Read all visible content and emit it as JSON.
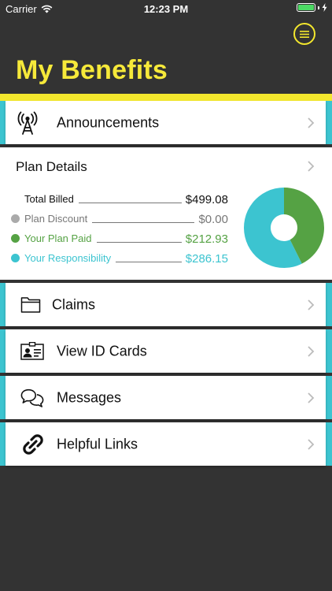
{
  "status": {
    "carrier": "Carrier",
    "time": "12:23 PM",
    "battery_percent": 100
  },
  "header": {
    "title": "My Benefits",
    "menu_icon": "hamburger-icon"
  },
  "colors": {
    "accent_yellow": "#f3e72d",
    "accent_teal": "#3cc4d0",
    "background": "#333333",
    "paid_green": "#55a244",
    "discount_gray": "#aaaaaa",
    "responsibility_teal": "#3cc4d0"
  },
  "announcements": {
    "label": "Announcements",
    "icon": "antenna-icon"
  },
  "plan_details": {
    "title": "Plan Details",
    "lines": [
      {
        "label": "Total Billed",
        "value": "$499.08",
        "color": "#111111"
      },
      {
        "label": "Plan Discount",
        "value": "$0.00",
        "color": "#777777",
        "dot": "#aaaaaa"
      },
      {
        "label": "Your Plan Paid",
        "value": "$212.93",
        "color": "#55a244",
        "dot": "#55a244"
      },
      {
        "label": "Your Responsibility",
        "value": "$286.15",
        "color": "#3cc4d0",
        "dot": "#3cc4d0"
      }
    ]
  },
  "chart_data": {
    "type": "pie",
    "donut": true,
    "slices": [
      {
        "name": "Your Plan Paid",
        "value": 212.93,
        "color": "#55a244"
      },
      {
        "name": "Your Responsibility",
        "value": 286.15,
        "color": "#3cc4d0"
      },
      {
        "name": "Plan Discount",
        "value": 0.0,
        "color": "#aaaaaa"
      }
    ]
  },
  "nav": [
    {
      "label": "Claims",
      "icon": "folder-icon"
    },
    {
      "label": "View ID Cards",
      "icon": "id-card-icon"
    },
    {
      "label": "Messages",
      "icon": "chat-bubbles-icon"
    },
    {
      "label": "Helpful Links",
      "icon": "link-icon"
    }
  ]
}
